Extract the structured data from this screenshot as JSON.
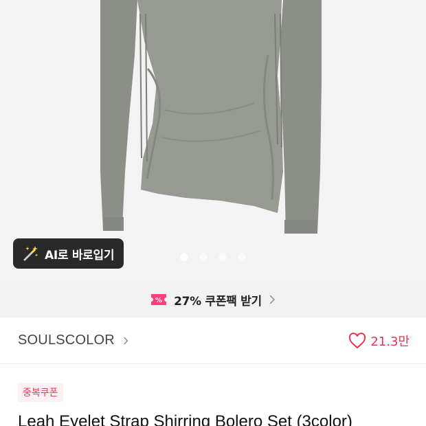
{
  "ai_button": {
    "label": "AI로 바로입기",
    "icon": "magic-wand-icon"
  },
  "carousel": {
    "count": 4,
    "active_index": 0
  },
  "coupon": {
    "text": "27% 쿠폰팩 받기",
    "icon": "coupon-ticket-icon",
    "color": "#ff3d7f"
  },
  "brand": {
    "name": "SOULSCOLOR",
    "likes": "21.3만",
    "like_color": "#e0384f"
  },
  "badge": {
    "label": "중복쿠폰"
  },
  "product": {
    "title": "Leah Eyelet Strap Shirring Bolero Set (3color)"
  }
}
